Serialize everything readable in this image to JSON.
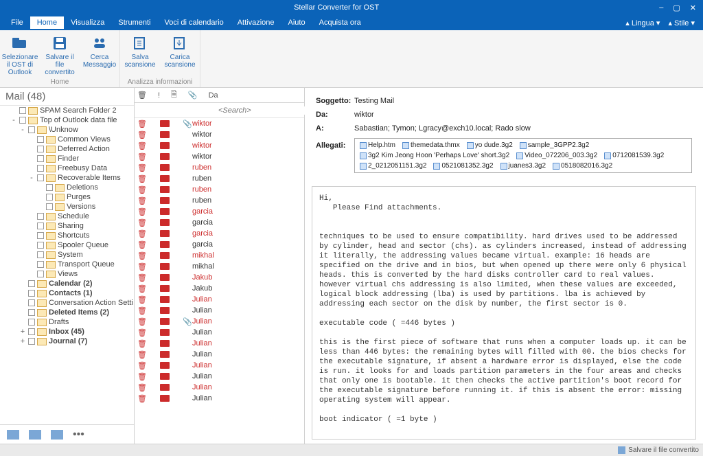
{
  "app_title": "Stellar Converter for OST",
  "window_controls": {
    "min": "–",
    "max": "▢",
    "close": "✕"
  },
  "menu": {
    "tabs": [
      {
        "label": "File"
      },
      {
        "label": "Home",
        "active": true
      },
      {
        "label": "Visualizza"
      },
      {
        "label": "Strumenti"
      },
      {
        "label": "Voci di calendario"
      },
      {
        "label": "Attivazione"
      },
      {
        "label": "Aiuto"
      },
      {
        "label": "Acquista ora"
      }
    ],
    "right": [
      {
        "label": "Lingua"
      },
      {
        "label": "Stile"
      }
    ]
  },
  "ribbon": {
    "groups": [
      {
        "label": "Home",
        "buttons": [
          {
            "label": "Selezionare il OST di Outlook",
            "icon": "folder-outlook-icon"
          },
          {
            "label": "Salvare il file convertito",
            "icon": "save-icon"
          },
          {
            "label": "Cerca Messaggio",
            "icon": "search-people-icon"
          }
        ]
      },
      {
        "label": "Analizza informazioni",
        "buttons": [
          {
            "label": "Salva scansione",
            "icon": "save-scan-icon"
          },
          {
            "label": "Carica scansione",
            "icon": "load-scan-icon"
          }
        ]
      }
    ]
  },
  "tree": {
    "title": "Mail (48)",
    "items": [
      {
        "label": "SPAM Search Folder 2",
        "depth": 1
      },
      {
        "label": "Top of Outlook data file",
        "depth": 1,
        "exp": "-"
      },
      {
        "label": "\\Unknow",
        "depth": 2,
        "exp": "-"
      },
      {
        "label": "Common Views",
        "depth": 3
      },
      {
        "label": "Deferred Action",
        "depth": 3
      },
      {
        "label": "Finder",
        "depth": 3
      },
      {
        "label": "Freebusy Data",
        "depth": 3
      },
      {
        "label": "Recoverable Items",
        "depth": 3,
        "exp": "-"
      },
      {
        "label": "Deletions",
        "depth": 4
      },
      {
        "label": "Purges",
        "depth": 4
      },
      {
        "label": "Versions",
        "depth": 4
      },
      {
        "label": "Schedule",
        "depth": 3
      },
      {
        "label": "Sharing",
        "depth": 3
      },
      {
        "label": "Shortcuts",
        "depth": 3
      },
      {
        "label": "Spooler Queue",
        "depth": 3
      },
      {
        "label": "System",
        "depth": 3
      },
      {
        "label": "Transport Queue",
        "depth": 3
      },
      {
        "label": "Views",
        "depth": 3
      },
      {
        "label": "Calendar (2)",
        "depth": 2,
        "bold": true
      },
      {
        "label": "Contacts (1)",
        "depth": 2,
        "bold": true
      },
      {
        "label": "Conversation Action Setti",
        "depth": 2
      },
      {
        "label": "Deleted Items (2)",
        "depth": 2,
        "bold": true
      },
      {
        "label": "Drafts",
        "depth": 2
      },
      {
        "label": "Inbox (45)",
        "depth": 2,
        "bold": true,
        "exp": "+"
      },
      {
        "label": "Journal (7)",
        "depth": 2,
        "bold": true,
        "exp": "+"
      }
    ]
  },
  "msglist": {
    "headers": {
      "del": "🗑",
      "pri": "!",
      "doc": "🗎",
      "clip": "📎",
      "from": "Da"
    },
    "search_placeholder": "<Search>",
    "rows": [
      {
        "from": "wiktor",
        "clip": true
      },
      {
        "from": "wiktor",
        "black": true
      },
      {
        "from": "wiktor"
      },
      {
        "from": "wiktor",
        "black": true
      },
      {
        "from": "ruben"
      },
      {
        "from": "ruben",
        "black": true
      },
      {
        "from": "ruben"
      },
      {
        "from": "ruben",
        "black": true
      },
      {
        "from": "garcia"
      },
      {
        "from": "garcia",
        "black": true
      },
      {
        "from": "garcia"
      },
      {
        "from": "garcia",
        "black": true
      },
      {
        "from": "mikhal"
      },
      {
        "from": "mikhal",
        "black": true
      },
      {
        "from": "Jakub"
      },
      {
        "from": "Jakub",
        "black": true
      },
      {
        "from": "Julian"
      },
      {
        "from": "Julian",
        "black": true
      },
      {
        "from": "Julian",
        "clip": true
      },
      {
        "from": "Julian",
        "black": true
      },
      {
        "from": "Julian"
      },
      {
        "from": "Julian",
        "black": true
      },
      {
        "from": "Julian"
      },
      {
        "from": "Julian",
        "black": true
      },
      {
        "from": "Julian"
      },
      {
        "from": "Julian",
        "black": true
      }
    ]
  },
  "preview": {
    "k_subject": "Soggetto:",
    "subject": "Testing Mail",
    "k_from": "Da:",
    "from": "wiktor",
    "k_to": "A:",
    "to": "Sabastian; Tymon; Lgracy@exch10.local; Rado slow",
    "k_attach": "Allegati:",
    "attachments": [
      "Help.htm",
      "themedata.thmx",
      "yo dude.3g2",
      "sample_3GPP2.3g2",
      "3g2 Kim Jeong Hoon 'Perhaps Love' short.3g2",
      "Video_072206_003.3g2",
      "0712081539.3g2",
      "2_0212051151.3g2",
      "0521081352.3g2",
      "juanes3.3g2",
      "0518082016.3g2"
    ],
    "body": "Hi,\n   Please Find attachments.\n\n\ntechniques to be used to ensure compatibility. hard drives used to be addressed by cylinder, head and sector (chs). as cylinders increased, instead of addressing it literally, the addressing values became virtual. example: 16 heads are specified on the drive and in bios, but when opened up there were only 6 physical heads. this is converted by the hard disks controller card to real values. however virtual chs addressing is also limited, when these values are exceeded, logical block addressing (lba) is used by partitions. lba is achieved by addressing each sector on the disk by number, the first sector is 0.\n\nexecutable code ( =446 bytes )\n\nthis is the first piece of software that runs when a computer loads up. it can be less than 446 bytes: the remaining bytes will filled with 00. the bios checks for the executable signature, if absent a hardware error is displayed, else the code is run. it looks for and loads partition parameters in the four areas and checks that only one is bootable. it then checks the active partition's boot record for the executable signature before running it. if this is absent the error: missing operating system will appear.\n\nboot indicator ( =1 byte )"
  },
  "status": {
    "label": "Salvare il file convertito"
  }
}
